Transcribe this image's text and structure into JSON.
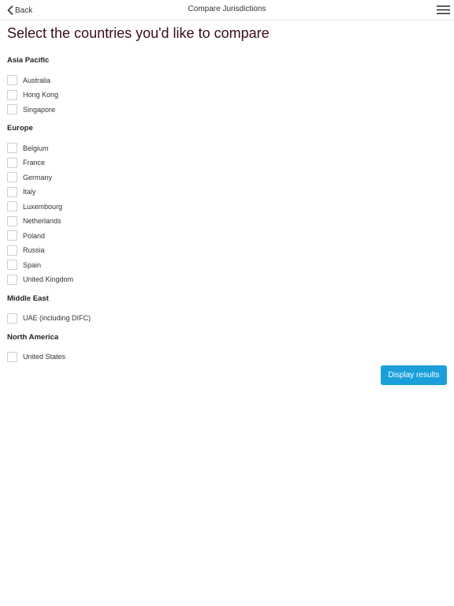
{
  "nav": {
    "back_label": "Back",
    "title": "Compare Jurisdictions"
  },
  "page": {
    "title": "Select the countries you'd like to compare"
  },
  "regions": [
    {
      "heading": "Asia Pacific",
      "countries": [
        "Australia",
        "Hong Kong",
        "Singapore"
      ]
    },
    {
      "heading": "Europe",
      "countries": [
        "Belgium",
        "France",
        "Germany",
        "Italy",
        "Luxembourg",
        "Netherlands",
        "Poland",
        "Russia",
        "Spain",
        "United Kingdom"
      ]
    },
    {
      "heading": "Middle East",
      "countries": [
        "UAE (including DIFC)"
      ]
    },
    {
      "heading": "North America",
      "countries": [
        "United States"
      ]
    }
  ],
  "actions": {
    "display_results_label": "Display results"
  },
  "colors": {
    "accent": "#1a9fdb",
    "title_text": "#3a0d1a"
  },
  "icons": {
    "back": "chevron-left-icon",
    "menu": "hamburger-menu-icon"
  }
}
